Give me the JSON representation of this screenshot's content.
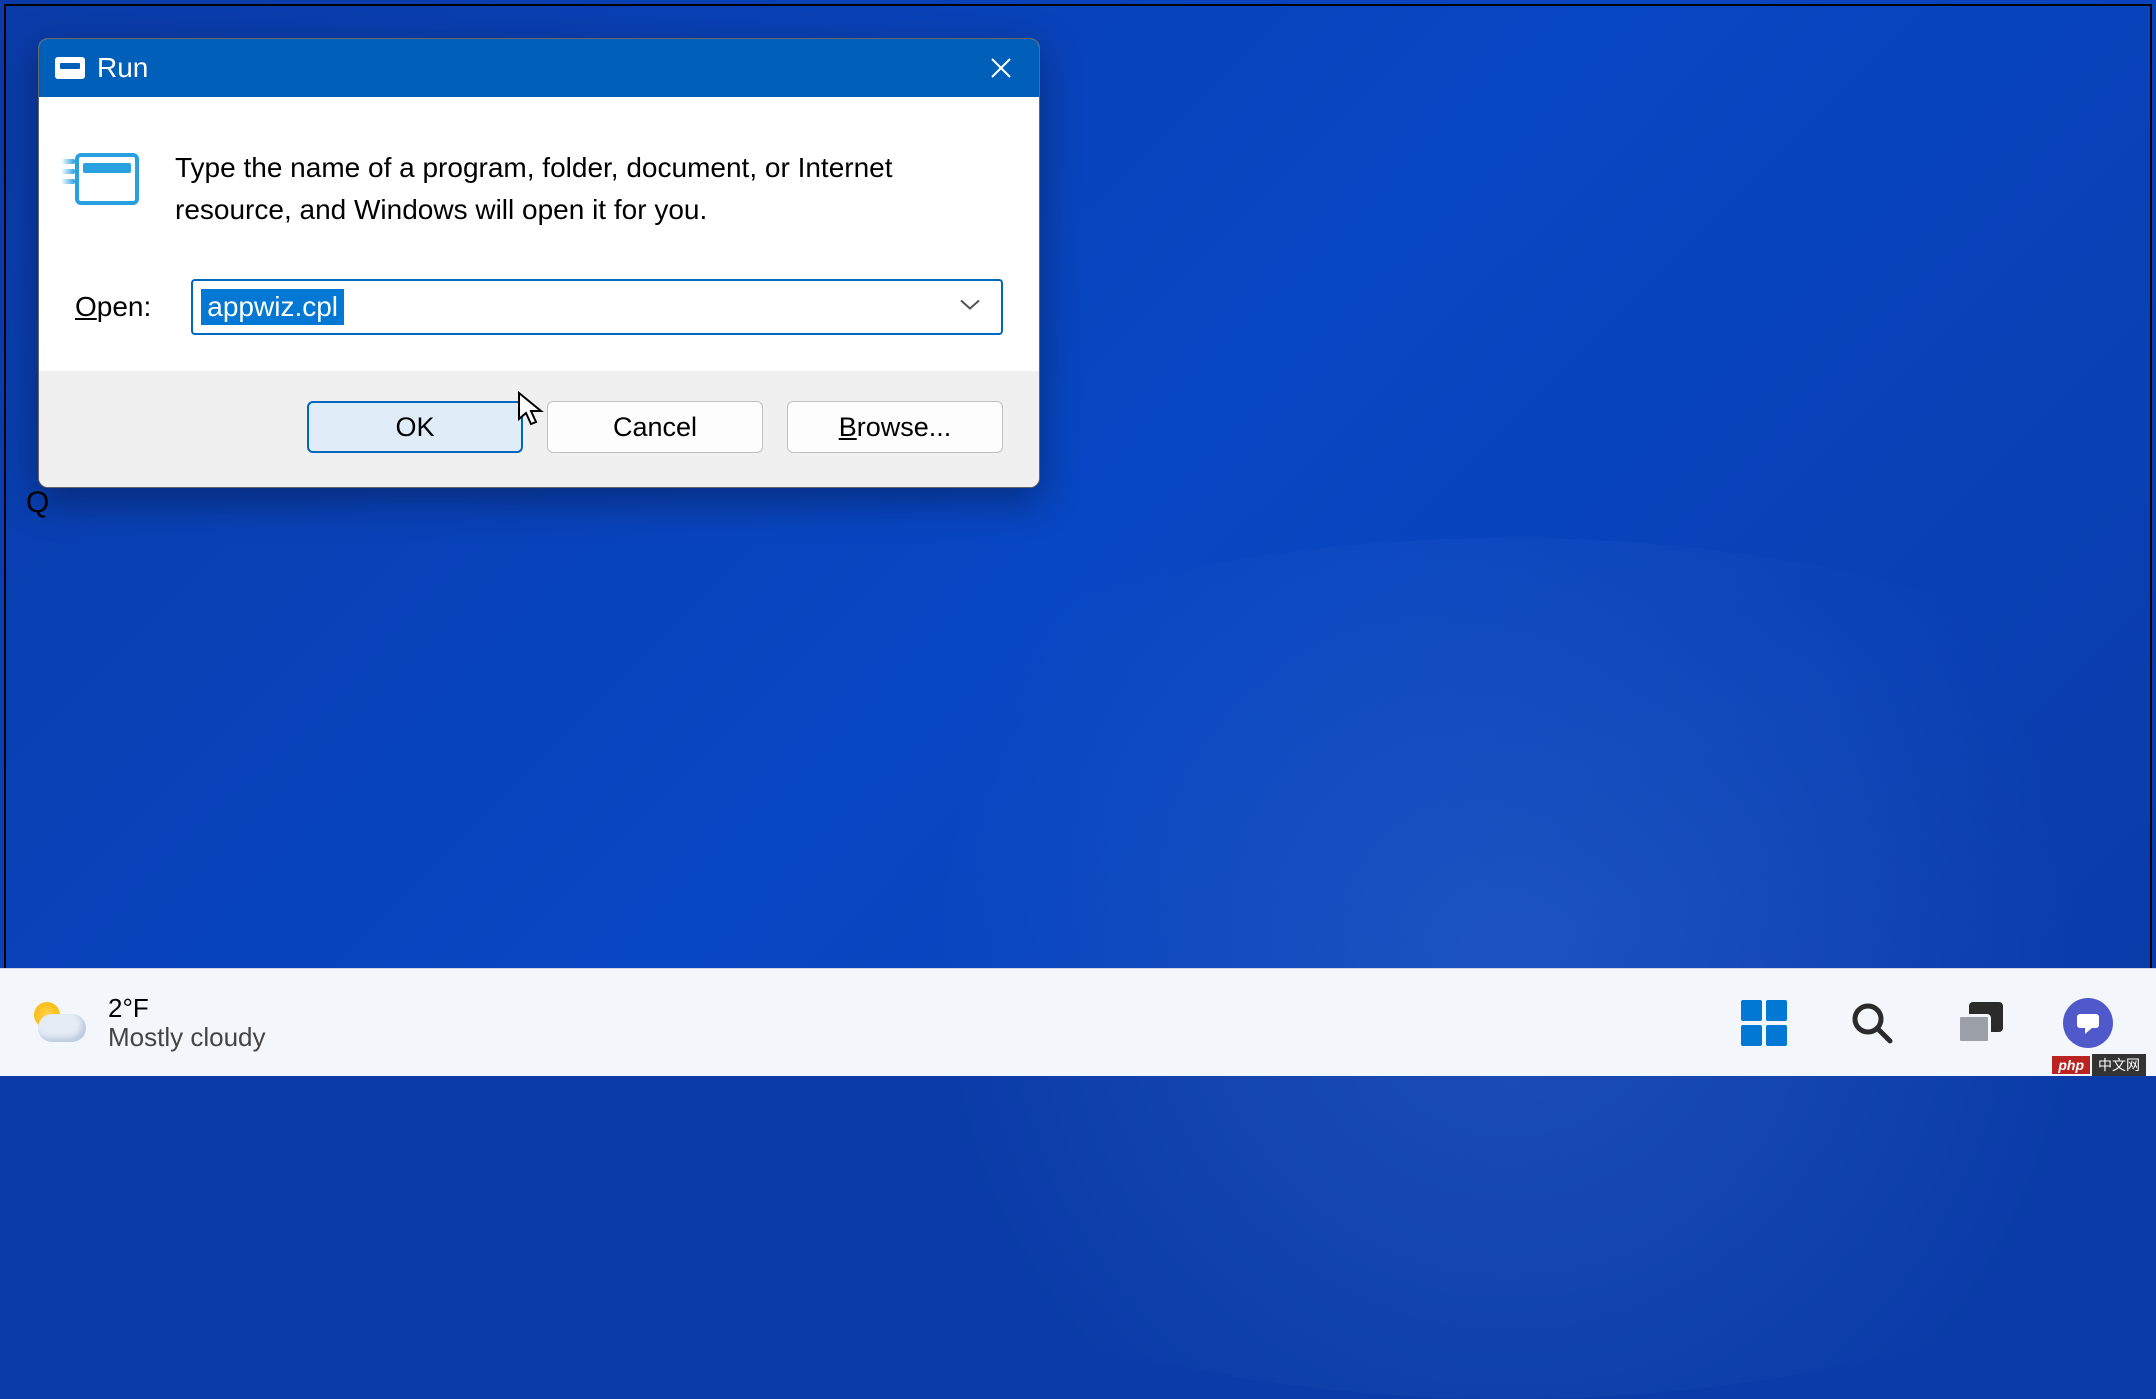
{
  "dialog": {
    "title": "Run",
    "description": "Type the name of a program, folder, document, or Internet resource, and Windows will open it for you.",
    "open_label_pre": "O",
    "open_label_rest": "pen:",
    "input_value": "appwiz.cpl",
    "buttons": {
      "ok": "OK",
      "cancel": "Cancel",
      "browse_pre": "B",
      "browse_rest": "rowse..."
    }
  },
  "taskbar": {
    "weather": {
      "temperature": "2°F",
      "condition": "Mostly cloudy"
    }
  },
  "watermark": {
    "part1": "php",
    "part2": "中文网"
  },
  "misc": {
    "stray_letter": "Q"
  }
}
